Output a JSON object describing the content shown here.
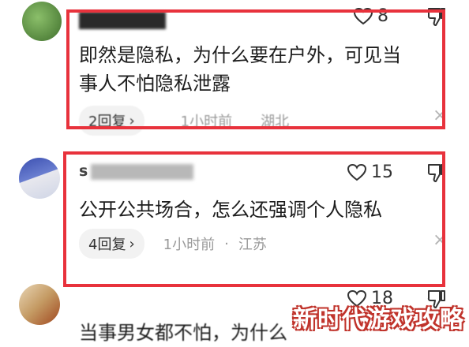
{
  "comments": [
    {
      "username_visible": "",
      "likes": "8",
      "text_line1": "即然是隐私，为什么要在户外，可见当",
      "text_line2": "事人不怕隐私泄露",
      "replies": "2回复",
      "time": "1小时前",
      "location": "湖北"
    },
    {
      "username_visible": "s",
      "likes": "15",
      "text_line1": "公开公共场合，怎么还强调个人隐私",
      "text_line2": "",
      "replies": "4回复",
      "time": "1小时前",
      "location": "江苏"
    },
    {
      "likes": "18",
      "text_line1": "当事男女都不怕，为什么"
    }
  ],
  "separator": "·",
  "chevron": "›",
  "close": "×",
  "watermark": "新时代游戏攻略",
  "colors": {
    "highlight": "#e8323c",
    "meta": "#9a9a9a"
  }
}
